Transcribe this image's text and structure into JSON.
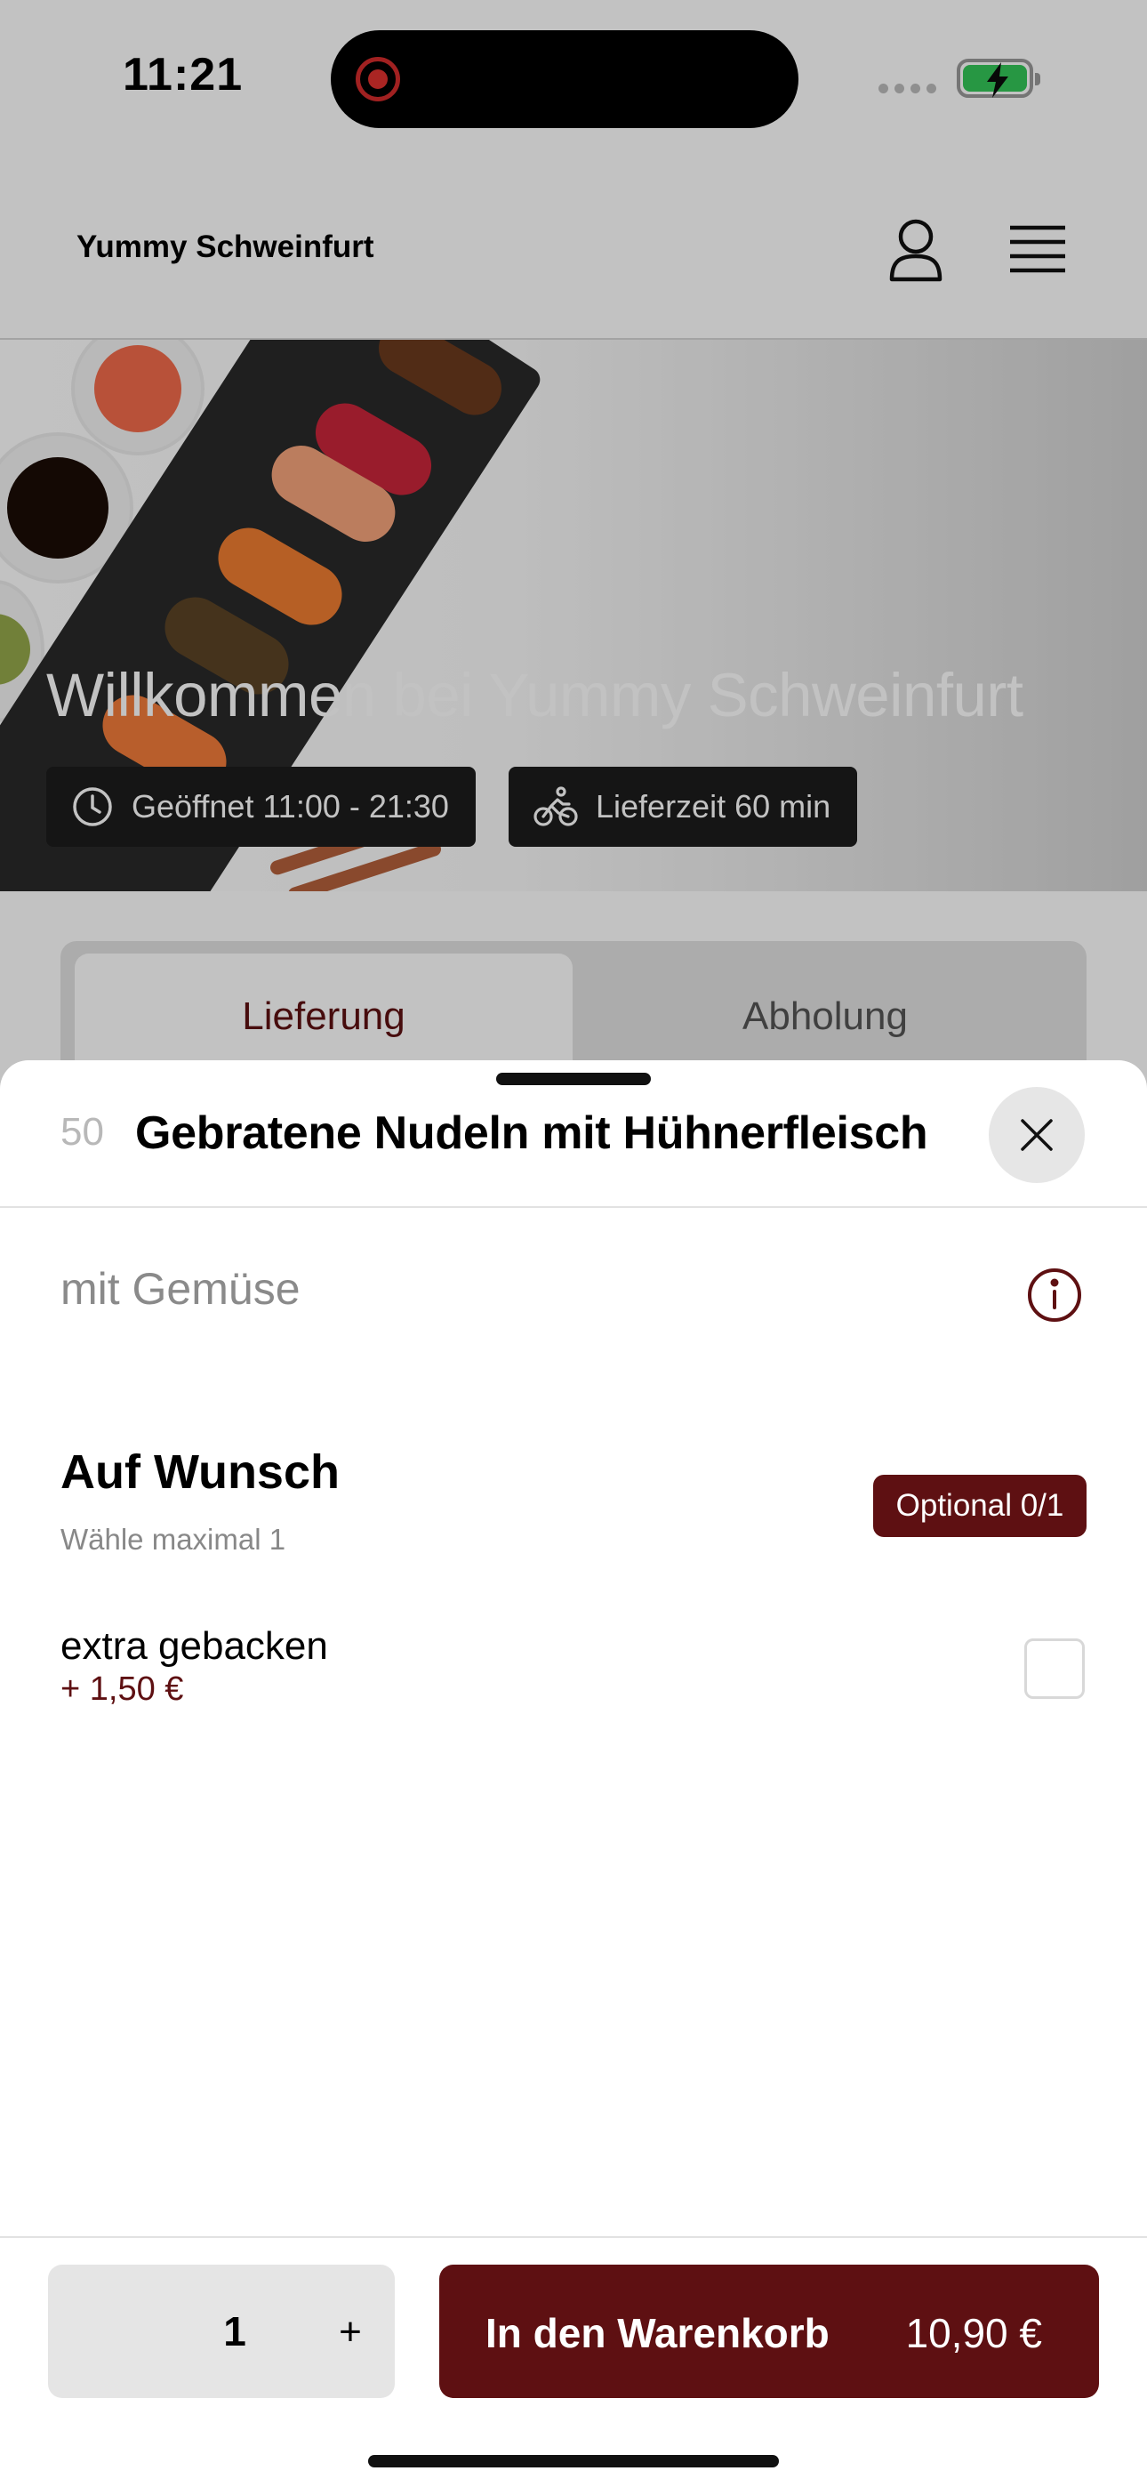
{
  "status_bar": {
    "time": "11:21"
  },
  "header": {
    "title": "Yummy Schweinfurt",
    "icons": [
      "user-icon",
      "menu-icon"
    ]
  },
  "hero": {
    "title": "Willkommen bei Yummy Schweinfurt",
    "opening": "Geöffnet 11:00 - 21:30",
    "delivery_time": "Lieferzeit 60 min"
  },
  "order_mode": {
    "tabs": [
      "Lieferung",
      "Abholung"
    ],
    "active": "Lieferung"
  },
  "sheet": {
    "number": "50",
    "title": "Gebratene Nudeln mit Hühnerfleisch",
    "description": "mit Gemüse",
    "group": {
      "title": "Auf Wunsch",
      "subtitle": "Wähle maximal 1",
      "badge": "Optional 0/1",
      "options": [
        {
          "label": "extra gebacken",
          "price": "+ 1,50 €",
          "checked": false
        }
      ]
    },
    "footer": {
      "quantity": "1",
      "plus": "+",
      "cart_label": "In den Warenkorb",
      "total": "10,90 €"
    }
  },
  "colors": {
    "accent": "#5e1012",
    "battery": "#34c759"
  }
}
